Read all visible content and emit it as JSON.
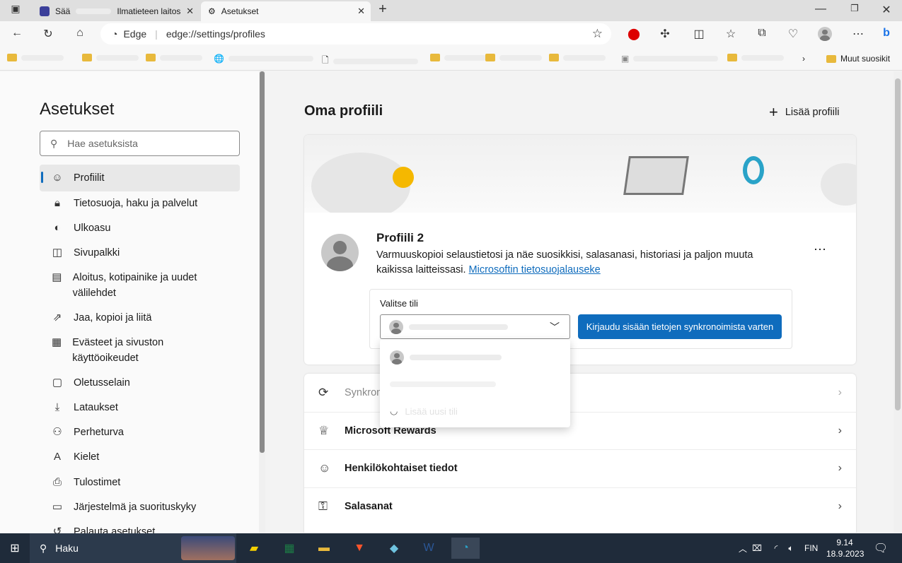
{
  "browser": {
    "tabs": [
      {
        "title": "Sää",
        "title_suffix": "Ilmatieteen laitos",
        "icon": "fmi-icon"
      },
      {
        "title": "Asetukset",
        "icon": "gear-icon"
      }
    ],
    "address_badge": "Edge",
    "url": "edge://settings/profiles",
    "favorites_other": "Muut suosikit"
  },
  "sidebar": {
    "title": "Asetukset",
    "search_placeholder": "Hae asetuksista",
    "items": [
      {
        "label": "Profiilit",
        "icon": "profile-icon",
        "active": true
      },
      {
        "label": "Tietosuoja, haku ja palvelut",
        "icon": "lock-icon"
      },
      {
        "label": "Ulkoasu",
        "icon": "palette-icon"
      },
      {
        "label": "Sivupalkki",
        "icon": "sidebar-icon"
      },
      {
        "label": "Aloitus, kotipainike ja uudet välilehdet",
        "icon": "home-icon"
      },
      {
        "label": "Jaa, kopioi ja liitä",
        "icon": "share-icon"
      },
      {
        "label": "Evästeet ja sivuston käyttöoikeudet",
        "icon": "cookie-icon"
      },
      {
        "label": "Oletusselain",
        "icon": "browser-icon"
      },
      {
        "label": "Lataukset",
        "icon": "download-icon"
      },
      {
        "label": "Perheturva",
        "icon": "family-icon"
      },
      {
        "label": "Kielet",
        "icon": "language-icon"
      },
      {
        "label": "Tulostimet",
        "icon": "printer-icon"
      },
      {
        "label": "Järjestelmä ja suorituskyky",
        "icon": "laptop-icon"
      },
      {
        "label": "Palauta asetukset",
        "icon": "reset-icon"
      }
    ]
  },
  "main": {
    "title": "Oma profiili",
    "add_profile": "Lisää profiili",
    "profile": {
      "name": "Profiili 2",
      "description": "Varmuuskopioi selaustietosi ja näe suosikkisi, salasanasi, historiasi ja paljon muuta kaikissa laitteissasi.",
      "privacy_link": "Microsoftin tietosuojalauseke",
      "account_label": "Valitse tili",
      "signin_button": "Kirjaudu sisään tietojen synkronoimista varten",
      "dropdown_add": "Lisää uusi tili"
    },
    "rows": [
      {
        "label": "Synkronoi",
        "icon": "sync-icon"
      },
      {
        "label": "Microsoft Rewards",
        "icon": "trophy-icon"
      },
      {
        "label": "Henkilökohtaiset tiedot",
        "icon": "person-card-icon"
      },
      {
        "label": "Salasanat",
        "icon": "key-icon"
      }
    ]
  },
  "taskbar": {
    "search": "Haku",
    "language": "FIN",
    "time": "9.14",
    "date": "18.9.2023"
  },
  "colors": {
    "accent": "#0f6cbd",
    "taskbar": "#1f2b3a"
  }
}
